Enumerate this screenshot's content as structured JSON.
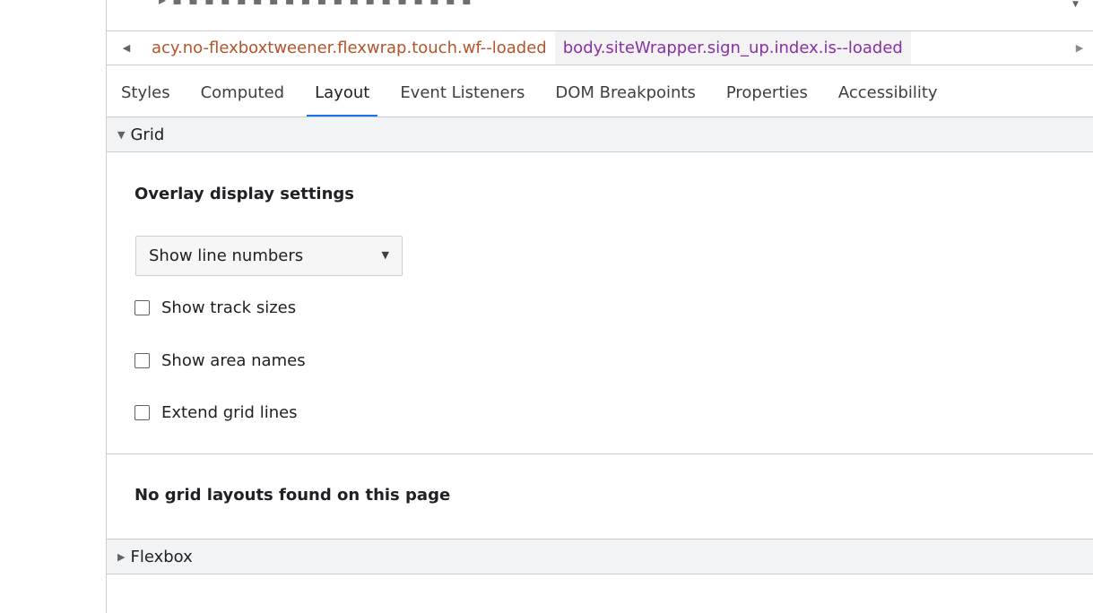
{
  "breadcrumbs": {
    "left_arrow": "◀",
    "right_arrow": "▶",
    "items": [
      "acy.no-flexboxtweener.flexwrap.touch.wf--loaded",
      "body.siteWrapper.sign_up.index.is--loaded"
    ],
    "first_color": "#b5532a",
    "second_color": "#8b2fa5"
  },
  "tabs": [
    {
      "label": "Styles",
      "active": false
    },
    {
      "label": "Computed",
      "active": false
    },
    {
      "label": "Layout",
      "active": true
    },
    {
      "label": "Event Listeners",
      "active": false
    },
    {
      "label": "DOM Breakpoints",
      "active": false
    },
    {
      "label": "Properties",
      "active": false
    },
    {
      "label": "Accessibility",
      "active": false
    }
  ],
  "accent_color": "#1a73e8",
  "grid": {
    "header": "Grid",
    "expanded_icon": "▼",
    "overlay_title": "Overlay display settings",
    "select": {
      "value": "Show line numbers",
      "caret": "▼"
    },
    "checkboxes": [
      {
        "label": "Show track sizes",
        "checked": false
      },
      {
        "label": "Show area names",
        "checked": false
      },
      {
        "label": "Extend grid lines",
        "checked": false
      }
    ],
    "empty_message": "No grid layouts found on this page"
  },
  "flexbox": {
    "header": "Flexbox",
    "collapsed_icon": "▶"
  }
}
